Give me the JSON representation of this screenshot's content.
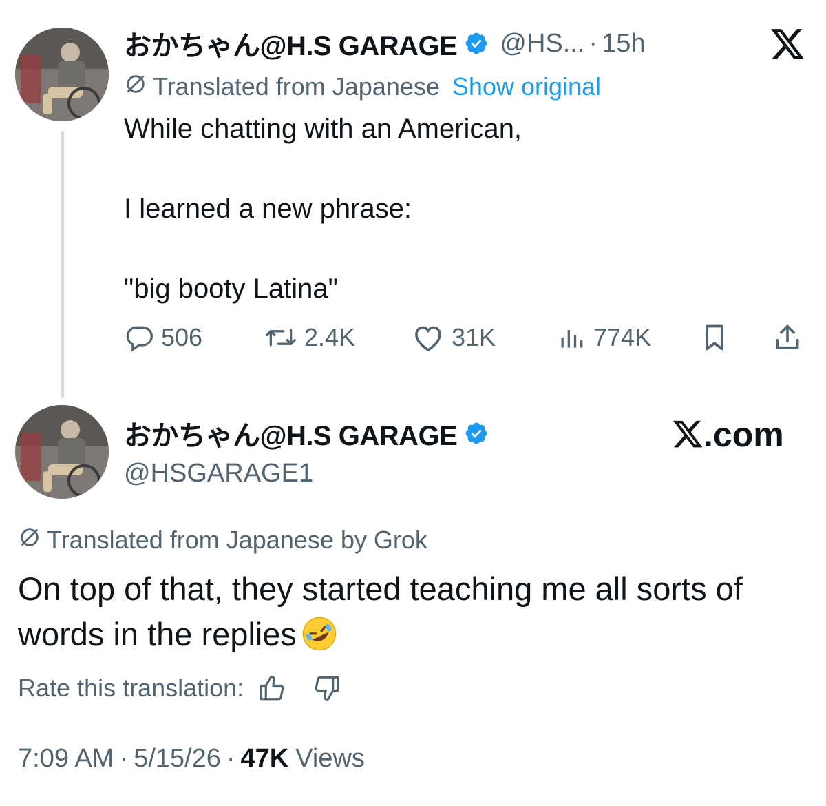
{
  "tweet": {
    "display_name": "おかちゃん@H.S GARAGE",
    "handle_short": "@HS...",
    "separator": "·",
    "time_ago": "15h",
    "translated_label": "Translated from Japanese",
    "show_original": "Show original",
    "text": "While chatting with an American,\n\nI learned a new phrase:\n\n\"big booty Latina\"",
    "replies": "506",
    "reposts": "2.4K",
    "likes": "31K",
    "views": "774K"
  },
  "reply": {
    "display_name": "おかちゃん@H.S GARAGE",
    "handle": "@HSGARAGE1",
    "site_label": ".com",
    "translated_label": "Translated from Japanese by Grok",
    "text": "On top of that, they started teaching me all sorts of words in the replies",
    "rate_label": "Rate this translation:",
    "time": "7:09 AM",
    "sep1": "·",
    "date": "5/15/26",
    "sep2": "·",
    "views_count": "47K",
    "views_label": "Views"
  },
  "icons": {
    "verified": "verified-badge-icon",
    "x_logo": "x-logo-icon",
    "translate": "translate-globe-icon",
    "reply": "reply-icon",
    "repost": "repost-icon",
    "like": "heart-icon",
    "views": "analytics-icon",
    "bookmark": "bookmark-icon",
    "share": "share-icon",
    "thumbs_up": "thumbs-up-icon",
    "thumbs_down": "thumbs-down-icon",
    "emoji": "rolling-on-floor-laughing-emoji"
  },
  "colors": {
    "text": "#0f1419",
    "secondary": "#536471",
    "accent": "#1d9bf0",
    "thread_line": "#cfd9de"
  }
}
